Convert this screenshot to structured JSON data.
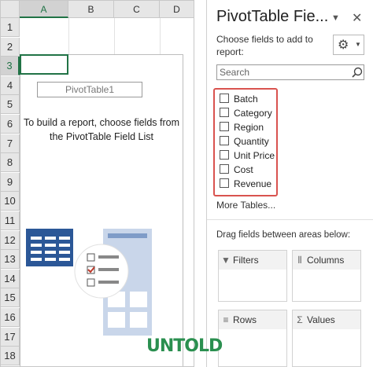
{
  "sheet": {
    "columns": [
      "A",
      "B",
      "C",
      "D"
    ],
    "rows": [
      "1",
      "2",
      "3",
      "4",
      "5",
      "6",
      "7",
      "8",
      "9",
      "10",
      "11",
      "12",
      "13",
      "14",
      "15",
      "16",
      "17",
      "18"
    ],
    "pivot_name": "PivotTable1",
    "pivot_message": "To build a report, choose fields from the PivotTable Field List"
  },
  "panel": {
    "title": "PivotTable Fie...",
    "dropdown_icon": "chevron-down-icon",
    "close_icon": "close-icon",
    "choose_text": "Choose fields to add to report:",
    "search_placeholder": "Search",
    "fields": [
      "Batch",
      "Category",
      "Region",
      "Quantity",
      "Unit Price",
      "Cost",
      "Revenue"
    ],
    "more_tables": "More Tables...",
    "drag_text": "Drag fields between areas below:",
    "areas": {
      "filters": "Filters",
      "columns": "Columns",
      "rows": "Rows",
      "values": "Values"
    }
  },
  "colors": {
    "accent": "#217346",
    "highlight_border": "#d9534f",
    "brand": "#2a8f4f"
  },
  "watermark": "UNTOLD"
}
